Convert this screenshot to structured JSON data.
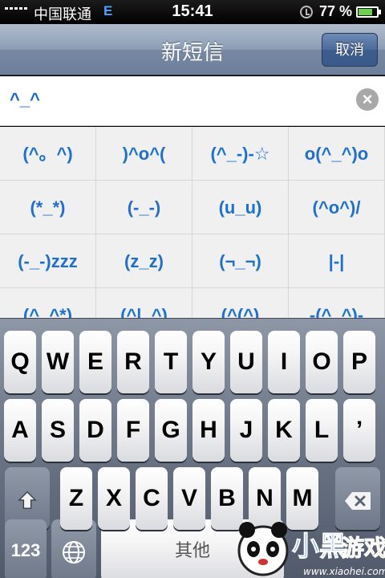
{
  "status_bar": {
    "carrier": "中国联通",
    "network": "E",
    "time": "15:41",
    "battery_percent": "77 %",
    "battery_level": 0.77,
    "lock_icon": "orientation-lock-icon"
  },
  "nav_bar": {
    "title": "新短信",
    "cancel_label": "取消"
  },
  "message": {
    "text": "^_^",
    "clear_icon": "clear-circle-icon"
  },
  "emoticons": [
    "(^。^)",
    ")^o^(",
    "(^_-)-☆",
    "o(^_^)o",
    "(*_*)",
    "(-_-)",
    "(u_u)",
    "(^o^)/",
    "(-_-)zzz",
    "(z_z)",
    "(¬_¬)",
    "|-|",
    "(^_^*)",
    "(^|_^)",
    "(^(^)",
    "-(^_^)-"
  ],
  "keyboard": {
    "row1": [
      "Q",
      "W",
      "E",
      "R",
      "T",
      "Y",
      "U",
      "I",
      "O",
      "P"
    ],
    "row2": [
      "A",
      "S",
      "D",
      "F",
      "G",
      "H",
      "J",
      "K",
      "L",
      "’"
    ],
    "row3": [
      "Z",
      "X",
      "C",
      "V",
      "B",
      "N",
      "M"
    ],
    "shift_icon": "shift-arrow-icon",
    "backspace_icon": "backspace-icon",
    "numbers_label": "123",
    "globe_icon": "globe-icon",
    "space_label": "其他"
  },
  "colors": {
    "emoticon_text": "#1d6fd0",
    "message_text": "#1e64c8",
    "nav_gradient_top": "#b0bccd",
    "cancel_button": "#4c6a9a"
  }
}
